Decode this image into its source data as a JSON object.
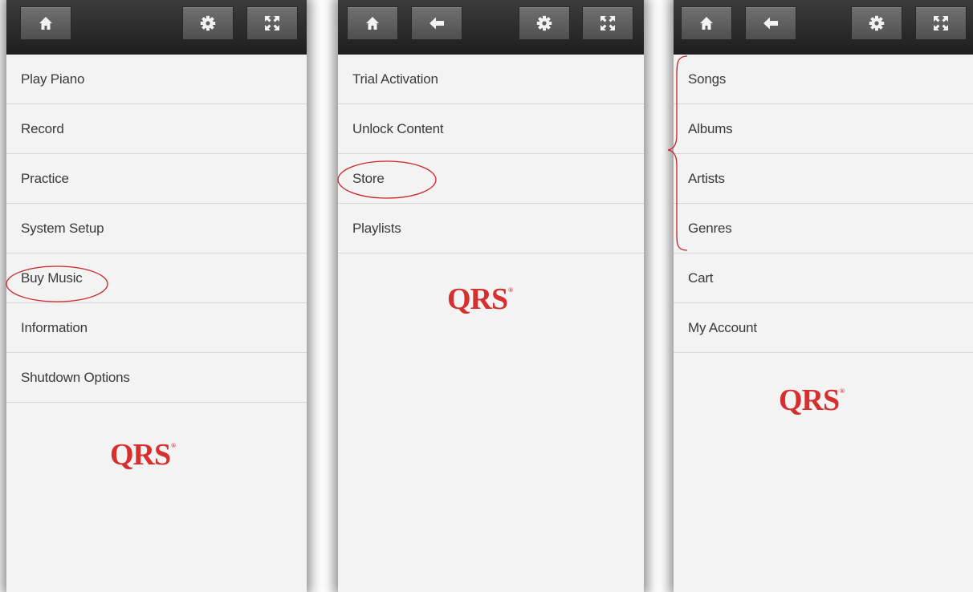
{
  "toolbar_icons": {
    "home": "home-icon",
    "back": "back-arrow-icon",
    "settings": "gear-icon",
    "fullscreen": "fullscreen-icon"
  },
  "panels": [
    {
      "menu": [
        "Play Piano",
        "Record",
        "Practice",
        "System Setup",
        "Buy Music",
        "Information",
        "Shutdown Options"
      ],
      "logo": {
        "text": "QRS",
        "mark": "®"
      }
    },
    {
      "menu": [
        "Trial Activation",
        "Unlock Content",
        "Store",
        "Playlists"
      ],
      "logo": {
        "text": "QRS",
        "mark": "®"
      }
    },
    {
      "menu": [
        "Songs",
        "Albums",
        "Artists",
        "Genres",
        "Cart",
        "My Account"
      ],
      "logo": {
        "text": "QRS",
        "mark": "®"
      }
    }
  ],
  "colors": {
    "brand_red": "#d62f2f",
    "annotation_red": "#cc2222",
    "panel_bg": "#f3f3f3",
    "toolbar_bg": "#2b2b2b"
  }
}
